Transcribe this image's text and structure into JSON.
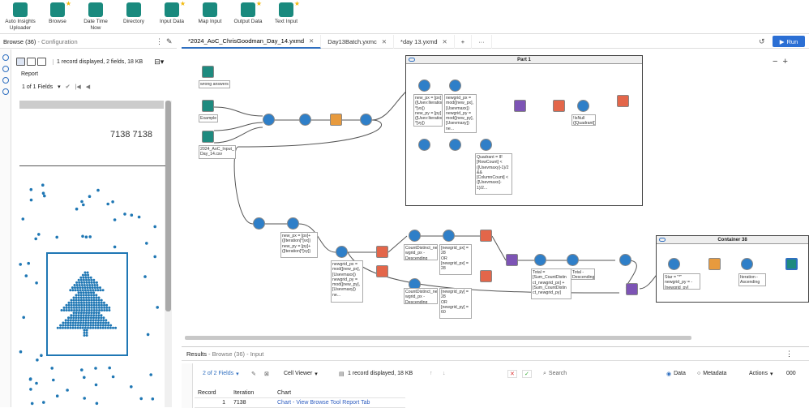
{
  "ribbon": {
    "tools": [
      {
        "label": "Auto Insights\nUploader",
        "icon": "auto-insights-icon",
        "starred": false
      },
      {
        "label": "Browse",
        "icon": "binoculars-icon",
        "starred": true
      },
      {
        "label": "Date Time\nNow",
        "icon": "calendar-clock-icon",
        "starred": false
      },
      {
        "label": "Directory",
        "icon": "directory-icon",
        "starred": false
      },
      {
        "label": "Input Data",
        "icon": "book-icon",
        "starred": true
      },
      {
        "label": "Map Input",
        "icon": "globe-icon",
        "starred": false
      },
      {
        "label": "Output Data",
        "icon": "book-output-icon",
        "starred": true
      },
      {
        "label": "Text Input",
        "icon": "text-book-icon",
        "starred": true
      }
    ]
  },
  "left_panel": {
    "title": "Browse (36)",
    "subtitle": " - Configuration",
    "record_info": "1 record displayed, 2 fields, 18 KB",
    "report_tab": "Report",
    "fields_label": "1 of 1 Fields",
    "numbers": "7138 7138"
  },
  "tabs": [
    {
      "label": "*2024_AoC_ChrisGoodman_Day_14.yxmd",
      "active": true
    },
    {
      "label": "Day13Batch.yxmc",
      "active": false
    },
    {
      "label": "*day 13.yxmd",
      "active": false
    }
  ],
  "run_label": "Run",
  "canvas": {
    "inputs": [
      "wrong answers",
      "Example",
      "2024_AoC_Input_\nDay_14.csv"
    ],
    "container1_title": "Part 1",
    "container2_title": "Container 38",
    "annotations": {
      "a1": "new_px = [px] +\n([Usev:Iteration\n*[vx])\nnew_py = [py] +\n([Usev:Iteration\n*[vy])",
      "a2": "newgrid_px =\nmod([new_px],\n[Usevmaxx])\nnewgrid_py =\nmod([new_py],\n[Usevmaxy])\nne...",
      "a3": "!IsNull\n([Quadrant])",
      "a4": "Quadrant = IF\n[RowCount] <\n([Usevmaxy]-1)/2\n&&\n[ColumnCount] <\n([Usevmaxx]-\n1)/2...",
      "a5": "new_px = [px]+\n([Iteration]*[vx])\nnew_py = [py]+\n([Iteration]*[vy])",
      "a6": "newgrid_px =\nmod([new_px],\n[Usevmaxx])\nnewgrid_py =\nmod([new_py],\n[Usevmaxy])\nne...",
      "a7": "CountDistinct_ne\nwgrid_px -\nDescending",
      "a8": "[newgrid_px] =\n28\nOR\n[newgrid_px] =\n28",
      "a9": "CountDistinct_ne\nwgrid_px -\nDescending",
      "a10": "[newgrid_py] =\n28\nOR\n[newgrid_py] =\n60",
      "a11": "Total =\n[Sum_CountDistin\nct_newgrid_px] +\n[Sum_CountDistin\nct_newgrid_py]",
      "a12": "Total -\nDescending",
      "a13": "Star = \"*\"\nnewgrid_py = -\n[newgrid_py]",
      "a14": "Iteration -\nAscending"
    }
  },
  "results": {
    "title": "Results",
    "subtitle": " - Browse (36) - Input",
    "fields": "2 of 2 Fields",
    "viewer": "Cell Viewer",
    "record_info": "1 record displayed, 18 KB",
    "search_placeholder": "Search",
    "data_label": "Data",
    "metadata_label": "Metadata",
    "actions_label": "Actions",
    "columns": [
      "Record",
      "Iteration",
      "Chart"
    ],
    "row": {
      "record": "1",
      "iteration": "7138",
      "chart": "Chart - View Browse Tool Report Tab"
    }
  },
  "colors": {
    "accent": "#2b6fd4",
    "tool_teal": "#1e8a7f",
    "scatter_dot": "#1f77b4"
  }
}
